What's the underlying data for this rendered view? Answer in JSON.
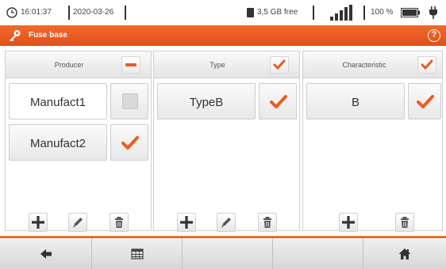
{
  "status": {
    "time": "16:01:37",
    "date": "2020-03-26",
    "free_space": "3,5 GB free",
    "battery": "100 %"
  },
  "titlebar": {
    "title": "Fuse base",
    "help": "?"
  },
  "columns": [
    {
      "header": "Producer",
      "header_state": "partial",
      "items": [
        {
          "label": "Manufact1",
          "checked": false
        },
        {
          "label": "Manufact2",
          "checked": true
        }
      ],
      "tools": [
        "add-icon",
        "edit-icon",
        "delete-icon"
      ]
    },
    {
      "header": "Type",
      "header_state": "checked",
      "items": [
        {
          "label": "TypeB",
          "checked": true
        }
      ],
      "tools": [
        "add-icon",
        "edit-icon",
        "delete-icon"
      ]
    },
    {
      "header": "Characteristic",
      "header_state": "checked",
      "items": [
        {
          "label": "B",
          "checked": true
        }
      ],
      "tools": [
        "add-icon",
        "delete-icon"
      ]
    }
  ],
  "footer": {
    "buttons": [
      "back-arrow-icon",
      "table-icon",
      "",
      "",
      "home-icon"
    ]
  },
  "colors": {
    "accent": "#e8561e",
    "check": "#f05a1e"
  }
}
